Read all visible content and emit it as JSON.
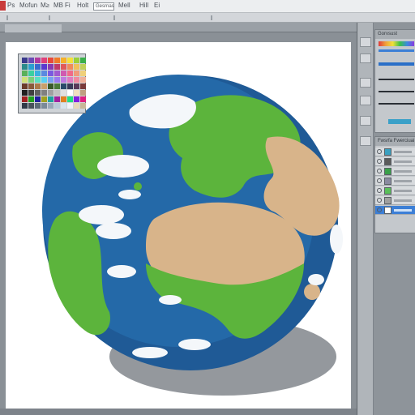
{
  "menubar": {
    "items": [
      "Ps",
      "Mofun",
      "M≥",
      "MB",
      "Fi",
      "Holt",
      "Geraps",
      "Mell",
      "Hill",
      "Ei"
    ],
    "field_text": "Gesrnas"
  },
  "panels": {
    "top_tab": "Gorvsust",
    "layers_tab": "Fwsrfa Fwerciuai"
  },
  "swatches": {
    "colors": [
      "#3a3a8c",
      "#6a4bb5",
      "#b03aa0",
      "#e0407a",
      "#e84a3a",
      "#f07a2a",
      "#f5b02a",
      "#f5e03a",
      "#9ad03a",
      "#3ab04a",
      "#2a8a8a",
      "#2aa0d0",
      "#3a6ad0",
      "#5a3ad0",
      "#8a3ab0",
      "#c03a6a",
      "#e05a5a",
      "#f08a5a",
      "#f0c05a",
      "#c0d05a",
      "#5ab05a",
      "#3ad0a0",
      "#3ab0e0",
      "#5a8ae0",
      "#7a5ae0",
      "#a05ad0",
      "#d05ab0",
      "#f06a8a",
      "#f09a7a",
      "#f0d07a",
      "#d0e07a",
      "#7ad07a",
      "#5ae0c0",
      "#5ad0f0",
      "#7aa0f0",
      "#9a7af0",
      "#c07ae0",
      "#e07ac0",
      "#f08aa0",
      "#f0b09a",
      "#6a3a2a",
      "#8a5a3a",
      "#aa7a4a",
      "#caa06a",
      "#3a5a2a",
      "#4a7a3a",
      "#2a4a6a",
      "#3a3a5a",
      "#5a3a5a",
      "#7a3a3a",
      "#202020",
      "#404040",
      "#606060",
      "#808080",
      "#a0a0a0",
      "#c0c0c0",
      "#e0e0e0",
      "#ffffff",
      "#f0e0c0",
      "#c0a080",
      "#a02020",
      "#20a020",
      "#2020a0",
      "#a0a020",
      "#20a0a0",
      "#a020a0",
      "#e08020",
      "#20e080",
      "#8020e0",
      "#e02080",
      "#303a48",
      "#48525c",
      "#5c6a78",
      "#7a8a98",
      "#98a8b8",
      "#b8c8d8",
      "#d8e4ee",
      "#f0f4f8",
      "#e8d8b8",
      "#c8b898"
    ]
  },
  "layers": [
    {
      "thumb_color": "#3aa0c0",
      "active": false
    },
    {
      "thumb_color": "#5a5a5a",
      "active": false
    },
    {
      "thumb_color": "#3aa04a",
      "active": false
    },
    {
      "thumb_color": "#8a8aa0",
      "active": false
    },
    {
      "thumb_color": "#5ac05a",
      "active": false
    },
    {
      "thumb_color": "#a0a0a0",
      "active": false
    },
    {
      "thumb_color": "#ffffff",
      "active": true
    }
  ],
  "colors": {
    "ocean": "#1f5a96",
    "land_green": "#5cb43c",
    "land_tan": "#d8b48a",
    "cloud": "#f4f7fa",
    "selection": "#3c7fd6"
  }
}
